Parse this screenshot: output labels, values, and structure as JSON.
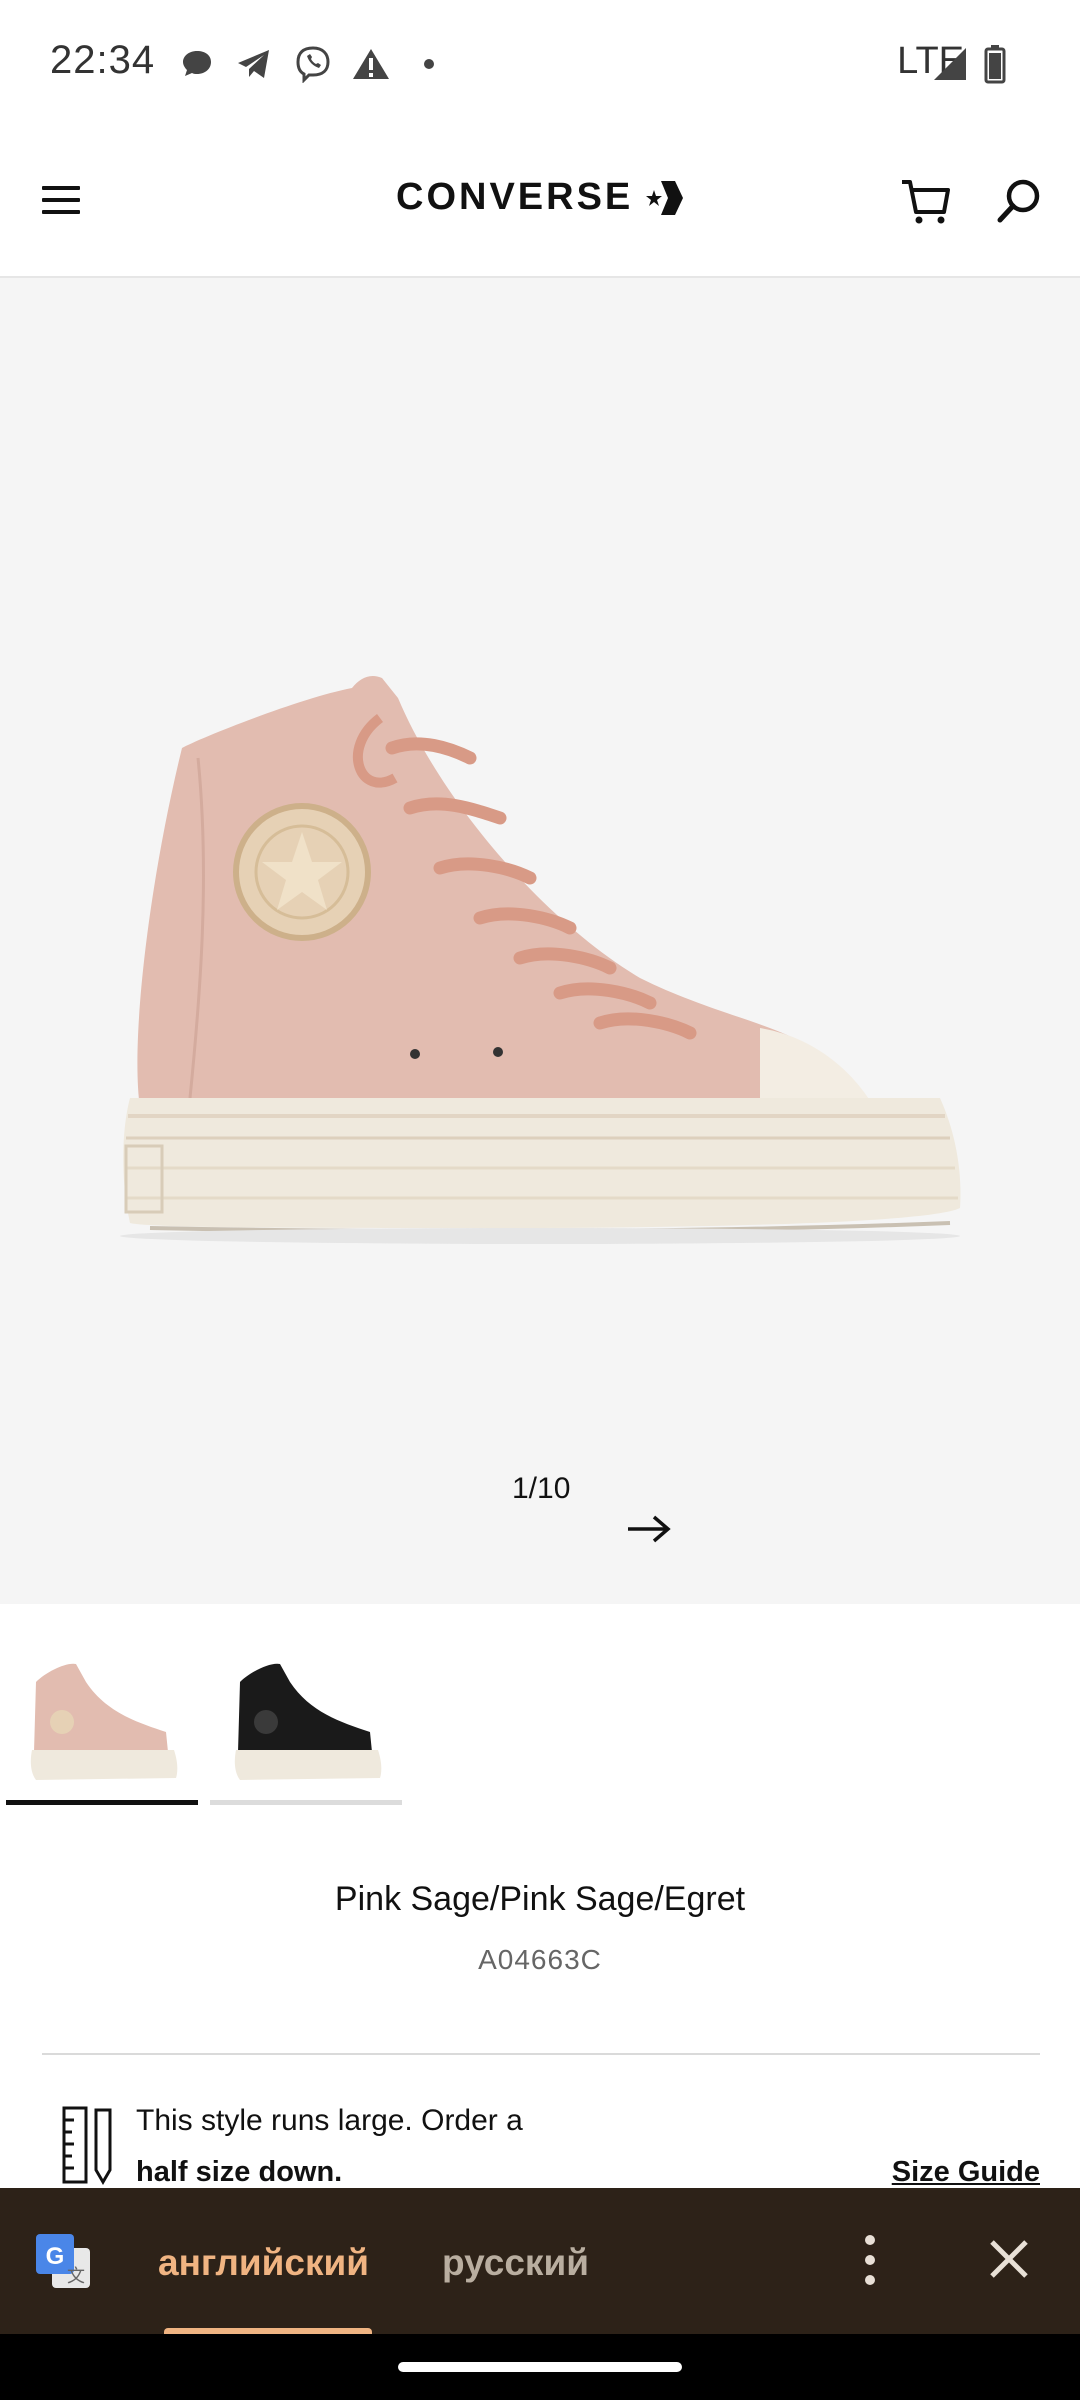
{
  "status_bar": {
    "time": "22:34",
    "network": "LTE",
    "icons": [
      "chat-icon",
      "telegram-icon",
      "viber-icon",
      "warning-icon",
      "dot-icon",
      "signal-icon",
      "battery-icon"
    ]
  },
  "header": {
    "logo": "CONVERSE",
    "icons": [
      "menu-icon",
      "cart-icon",
      "search-icon"
    ]
  },
  "gallery": {
    "counter": "1/10",
    "thumbnails": [
      {
        "color": "pink",
        "selected": true
      },
      {
        "color": "black",
        "selected": false
      }
    ]
  },
  "product": {
    "variant_name": "Pink Sage/Pink Sage/Egret",
    "sku": "A04663C",
    "fit_line1": "This style runs large. Order a",
    "fit_line2": "half size down.",
    "size_guide": "Size Guide"
  },
  "translate_bar": {
    "active_language": "английский",
    "other_language": "русский"
  },
  "colors": {
    "hero_bg": "#f5f5f5",
    "translate_bg": "#2d2218",
    "translate_accent": "#f0b482"
  }
}
